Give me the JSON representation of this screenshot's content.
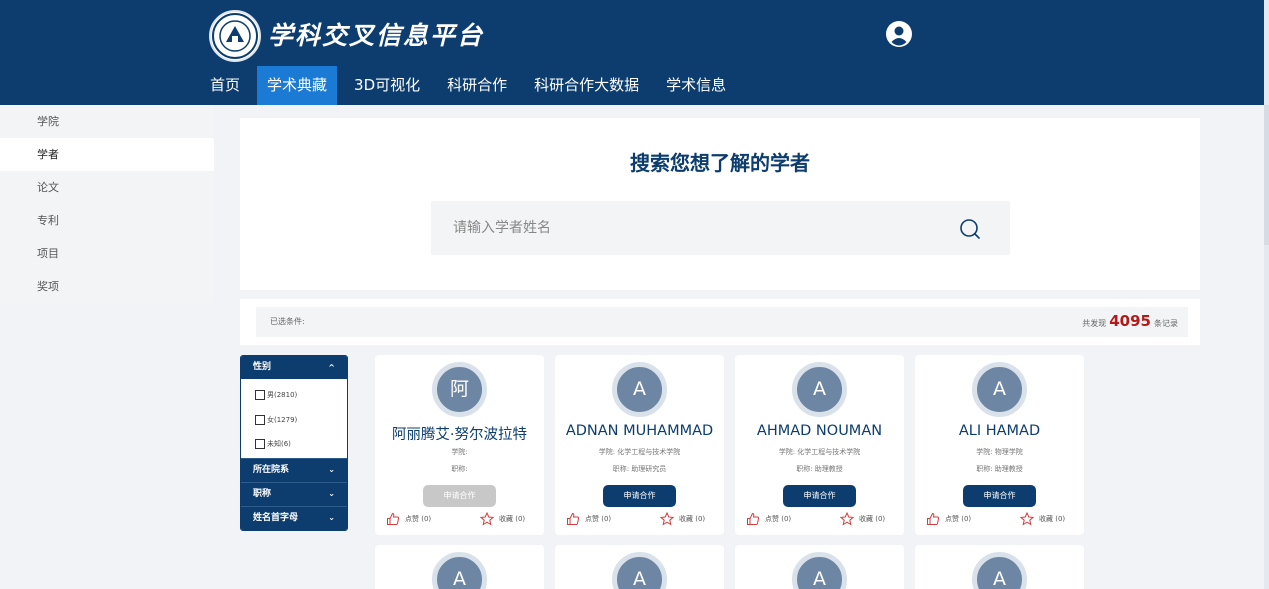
{
  "header": {
    "site_title": "学科交叉信息平台",
    "nav": [
      {
        "label": "首页"
      },
      {
        "label": "学术典藏",
        "active": true
      },
      {
        "label": "3D可视化"
      },
      {
        "label": "科研合作"
      },
      {
        "label": "科研合作大数据"
      },
      {
        "label": "学术信息"
      }
    ]
  },
  "sidebar": {
    "items": [
      {
        "label": "学院"
      },
      {
        "label": "学者",
        "active": true
      },
      {
        "label": "论文"
      },
      {
        "label": "专利"
      },
      {
        "label": "项目"
      },
      {
        "label": "奖项"
      }
    ]
  },
  "search": {
    "title": "搜索您想了解的学者",
    "placeholder": "请输入学者姓名",
    "value": ""
  },
  "filter": {
    "selected_label": "已选条件:",
    "result_prefix": "共发现",
    "result_count": "4095",
    "result_suffix": "条记录"
  },
  "facets": {
    "gender": {
      "title": "性别",
      "options": [
        {
          "label": "男(2810)"
        },
        {
          "label": "女(1279)"
        },
        {
          "label": "未知(6)"
        }
      ]
    },
    "college": {
      "title": "所在院系"
    },
    "rank": {
      "title": "职称"
    },
    "initial": {
      "title": "姓名首字母"
    }
  },
  "cards": [
    {
      "avatar": "阿",
      "name": "阿丽腾艾·努尔波拉特",
      "college": "学院:",
      "rank": "职称:",
      "button": "申请合作",
      "button_disabled": true,
      "like": "点赞 (0)",
      "fav": "收藏 (0)"
    },
    {
      "avatar": "A",
      "name": "ADNAN MUHAMMAD",
      "college": "学院: 化学工程与技术学院",
      "rank": "职称: 助理研究员",
      "button": "申请合作",
      "button_disabled": false,
      "like": "点赞 (0)",
      "fav": "收藏 (0)"
    },
    {
      "avatar": "A",
      "name": "AHMAD NOUMAN",
      "college": "学院: 化学工程与技术学院",
      "rank": "职称: 助理教授",
      "button": "申请合作",
      "button_disabled": false,
      "like": "点赞 (0)",
      "fav": "收藏 (0)"
    },
    {
      "avatar": "A",
      "name": "ALI HAMAD",
      "college": "学院: 物理学院",
      "rank": "职称: 助理教授",
      "button": "申请合作",
      "button_disabled": false,
      "like": "点赞 (0)",
      "fav": "收藏 (0)"
    }
  ],
  "cards_row2": [
    {
      "avatar": "A"
    },
    {
      "avatar": "A"
    },
    {
      "avatar": "A"
    },
    {
      "avatar": "A"
    }
  ],
  "colors": {
    "primary": "#0c3d6e",
    "nav_active": "#1b7ad3",
    "count": "#b31b1b",
    "like_icon": "#d33d3d"
  }
}
